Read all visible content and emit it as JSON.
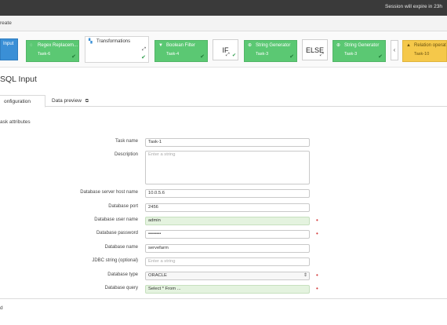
{
  "session": {
    "text": "Session  will expire in  23h"
  },
  "subbar": {
    "text": "reate"
  },
  "pipeline": {
    "nodes": [
      {
        "title": "Input",
        "sub": "",
        "color": "blue"
      },
      {
        "title": "Regex Replacem...",
        "sub": "Task-6",
        "color": "green"
      },
      {
        "title": "Transformations",
        "sub": "",
        "color": "white"
      },
      {
        "title": "Boolean Filter",
        "sub": "Task-4",
        "color": "green"
      },
      {
        "label": "IF"
      },
      {
        "title": "String Generator",
        "sub": "Task-3",
        "color": "green"
      },
      {
        "label": "ELSE"
      },
      {
        "title": "String Generator",
        "sub": "Task-3",
        "color": "green"
      },
      {
        "title": "Relation operato",
        "sub": "Task-10",
        "color": "yellow"
      }
    ]
  },
  "page": {
    "title": "SQL Input"
  },
  "tabs": {
    "config": "onfiguration",
    "preview": "Data preview"
  },
  "section": {
    "title": "ask attributes"
  },
  "form": {
    "task_name": {
      "label": "Task name",
      "value": "Task-1"
    },
    "description": {
      "label": "Description",
      "placeholder": "Enter a string"
    },
    "host": {
      "label": "Database server host name",
      "value": "10.0.5.6"
    },
    "port": {
      "label": "Database port",
      "value": "2456"
    },
    "user": {
      "label": "Database user name",
      "value": "admin"
    },
    "password": {
      "label": "Database password",
      "value": "••••••••"
    },
    "dbname": {
      "label": "Database name",
      "value": "servefarm"
    },
    "jdbc": {
      "label": "JDBC string (optional)",
      "placeholder": "Enter a string"
    },
    "dbtype": {
      "label": "Database type",
      "value": "ORACLE"
    },
    "query": {
      "label": "Database query",
      "value": "Select * From ..."
    }
  },
  "footer": {
    "text": "d"
  },
  "colors": {
    "green": "#5bc873",
    "blue": "#3a8fd6",
    "yellow": "#f5c84a",
    "required": "#d43c3c"
  }
}
